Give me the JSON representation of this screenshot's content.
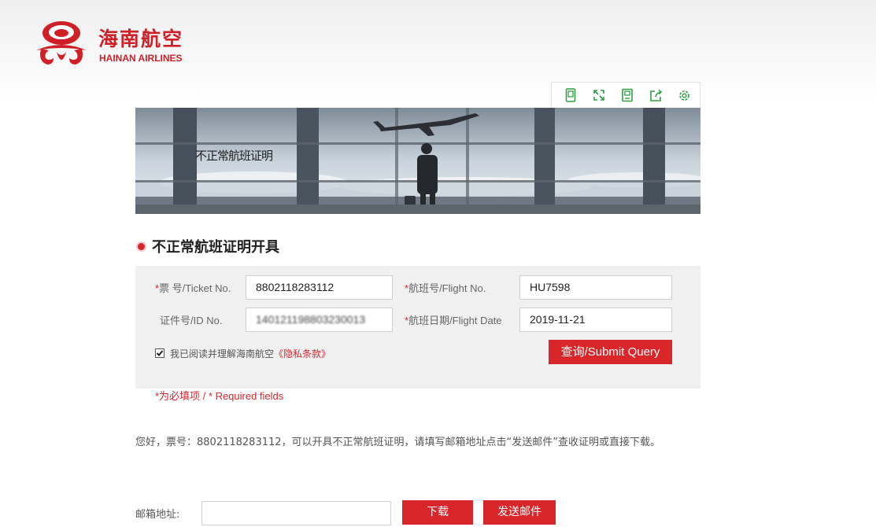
{
  "brand": {
    "name_cn": "海南航空",
    "name_en": "HAINAN AIRLINES",
    "color": "#cf2027"
  },
  "toolbar": {
    "icons": [
      "mobile-icon",
      "fullscreen-icon",
      "save-icon",
      "share-icon",
      "settings-icon"
    ],
    "color": "#2ea043"
  },
  "banner": {
    "title": "不正常航班证明"
  },
  "section": {
    "title": "不正常航班证明开具"
  },
  "form": {
    "ticket": {
      "required_mark": "*",
      "label": "票 号/Ticket No.",
      "value": "8802118283112"
    },
    "flight": {
      "required_mark": "*",
      "label": "航班号/Flight No.",
      "value": "HU7598"
    },
    "id": {
      "label": "证件号/ID No.",
      "value": "140121198803230013"
    },
    "date": {
      "required_mark": "*",
      "label": "航班日期/Flight Date",
      "value": "2019-11-21"
    },
    "agree": {
      "checked": true,
      "text": "我已阅读并理解海南航空",
      "link": "《隐私条款》"
    },
    "submit_label": "查询/Submit Query",
    "required_note": "*为必填项 / * Required fields"
  },
  "result": {
    "message": "您好，票号：8802118283112，可以开具不正常航班证明，请填写邮箱地址点击“发送邮件”查收证明或直接下载。",
    "email_label": "邮箱地址:",
    "email_value": "",
    "download_label": "下载",
    "send_label": "发送邮件"
  },
  "accent": "#d9262b"
}
